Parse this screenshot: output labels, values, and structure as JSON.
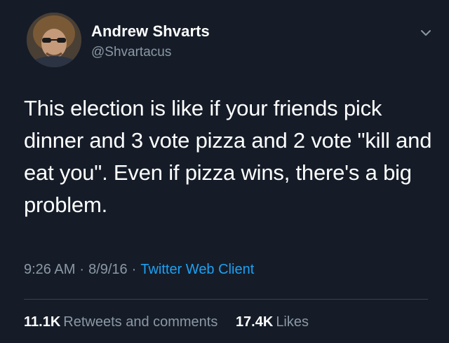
{
  "author": {
    "display_name": "Andrew Shvarts",
    "handle": "@Shvartacus",
    "avatar_icon": "profile-photo"
  },
  "tweet": {
    "text": "This election is like if your friends pick dinner and 3 vote pizza and 2 vote \"kill and eat you\". Even if pizza wins, there's a big problem."
  },
  "meta": {
    "time": "9:26 AM",
    "separator": "·",
    "date": "8/9/16",
    "source": "Twitter Web Client"
  },
  "stats": {
    "retweets_count": "11.1K",
    "retweets_label": "Retweets and comments",
    "likes_count": "17.4K",
    "likes_label": "Likes"
  },
  "colors": {
    "background": "#151c28",
    "primary_text": "#ffffff",
    "secondary_text": "#8b98a5",
    "link": "#1da1f2",
    "divider": "#38444d"
  },
  "icons": {
    "menu": "chevron-down-icon"
  }
}
